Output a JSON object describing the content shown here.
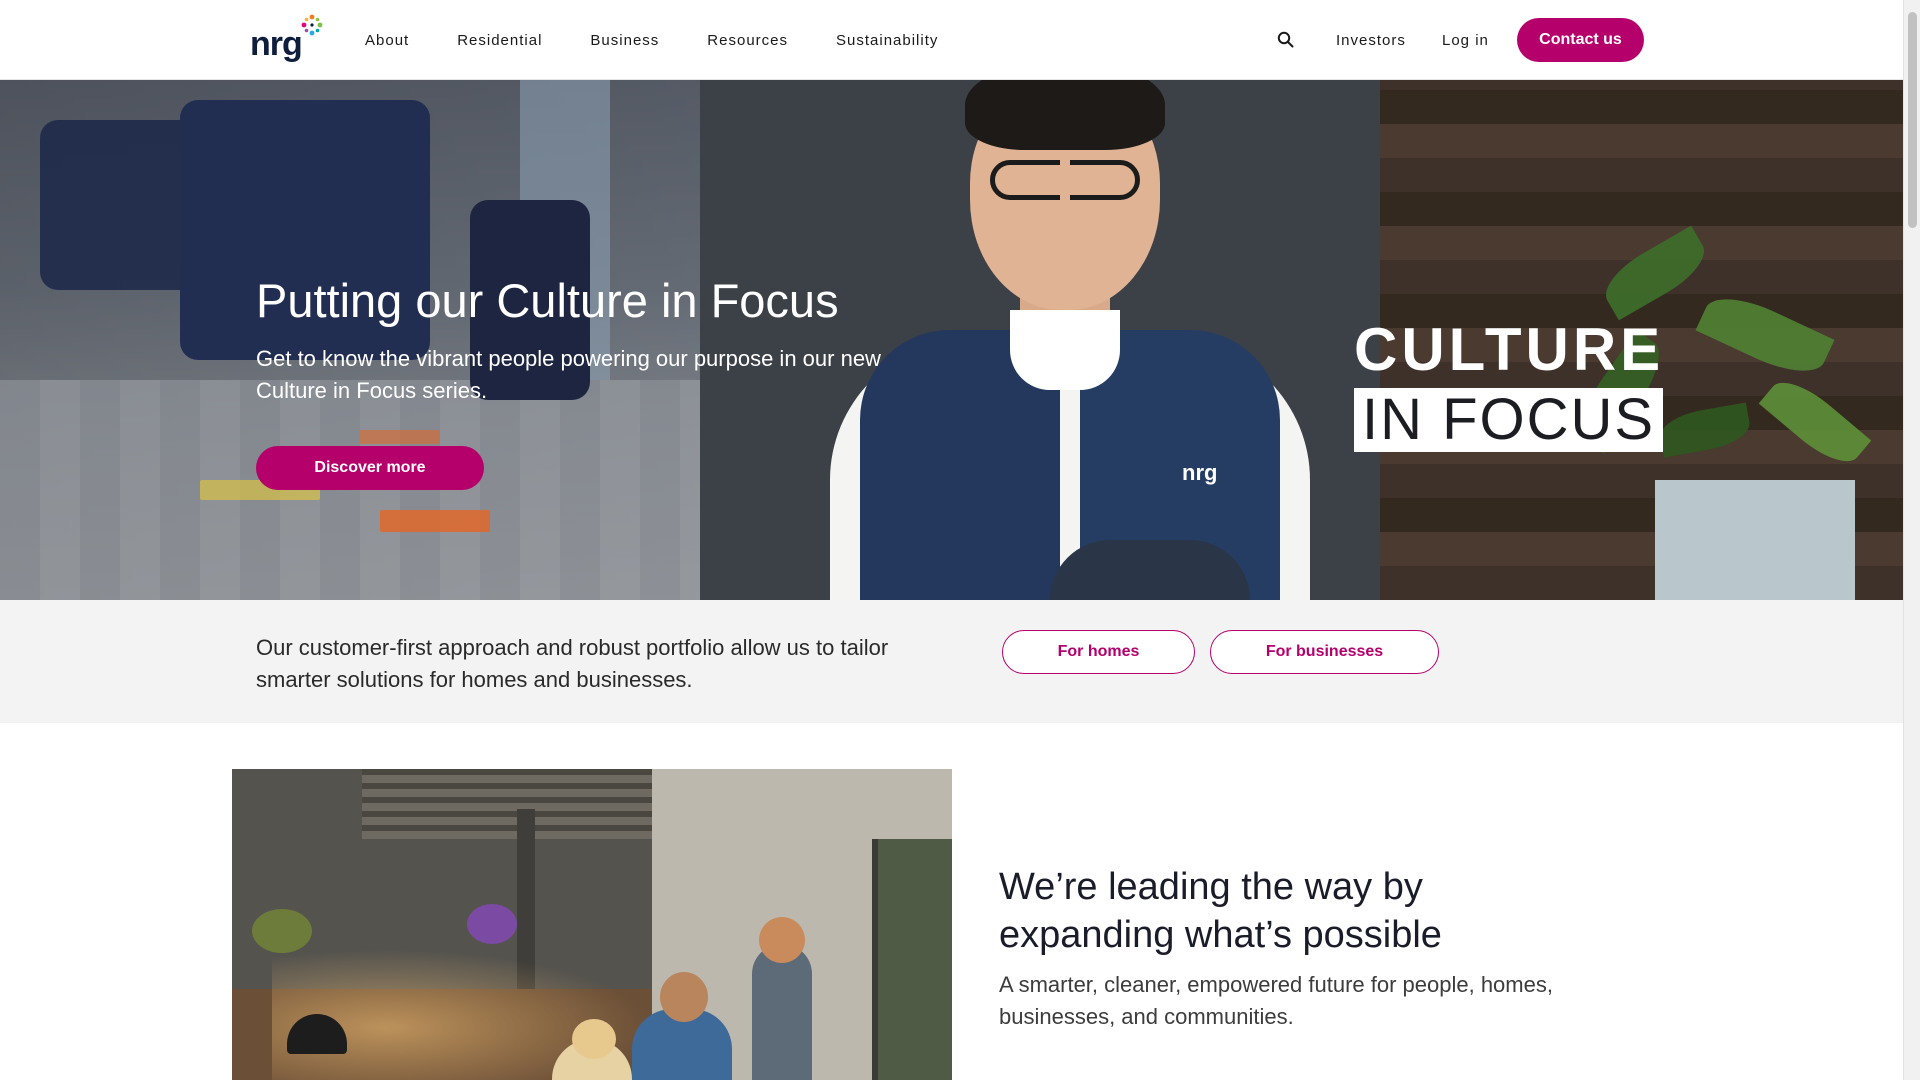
{
  "header": {
    "logo_text": "nrg",
    "nav": [
      {
        "label": "About"
      },
      {
        "label": "Residential"
      },
      {
        "label": "Business"
      },
      {
        "label": "Resources"
      },
      {
        "label": "Sustainability"
      }
    ],
    "utility": {
      "search_icon": "search-icon",
      "investors_label": "Investors",
      "login_label": "Log in",
      "contact_label": "Contact us"
    }
  },
  "hero": {
    "title": "Putting our Culture in Focus",
    "subtitle": "Get to know the vibrant people powering our purpose in our new Culture in Focus series.",
    "cta_label": "Discover more",
    "badge_line1": "CULTURE",
    "badge_line2": "IN FOCUS",
    "vest_logo_text": "nrg"
  },
  "band": {
    "text": "Our customer-first approach and robust portfolio allow us to tailor smarter solutions for homes and businesses.",
    "homes_label": "For homes",
    "business_label": "For businesses"
  },
  "feature": {
    "title": "We’re leading the way by expanding what’s possible",
    "subtitle": "A smarter, cleaner, empowered future for people, homes, businesses, and communities."
  },
  "colors": {
    "brand_magenta": "#b5006b",
    "logo_navy": "#0f1e3c",
    "band_bg": "#f3f3f3"
  }
}
